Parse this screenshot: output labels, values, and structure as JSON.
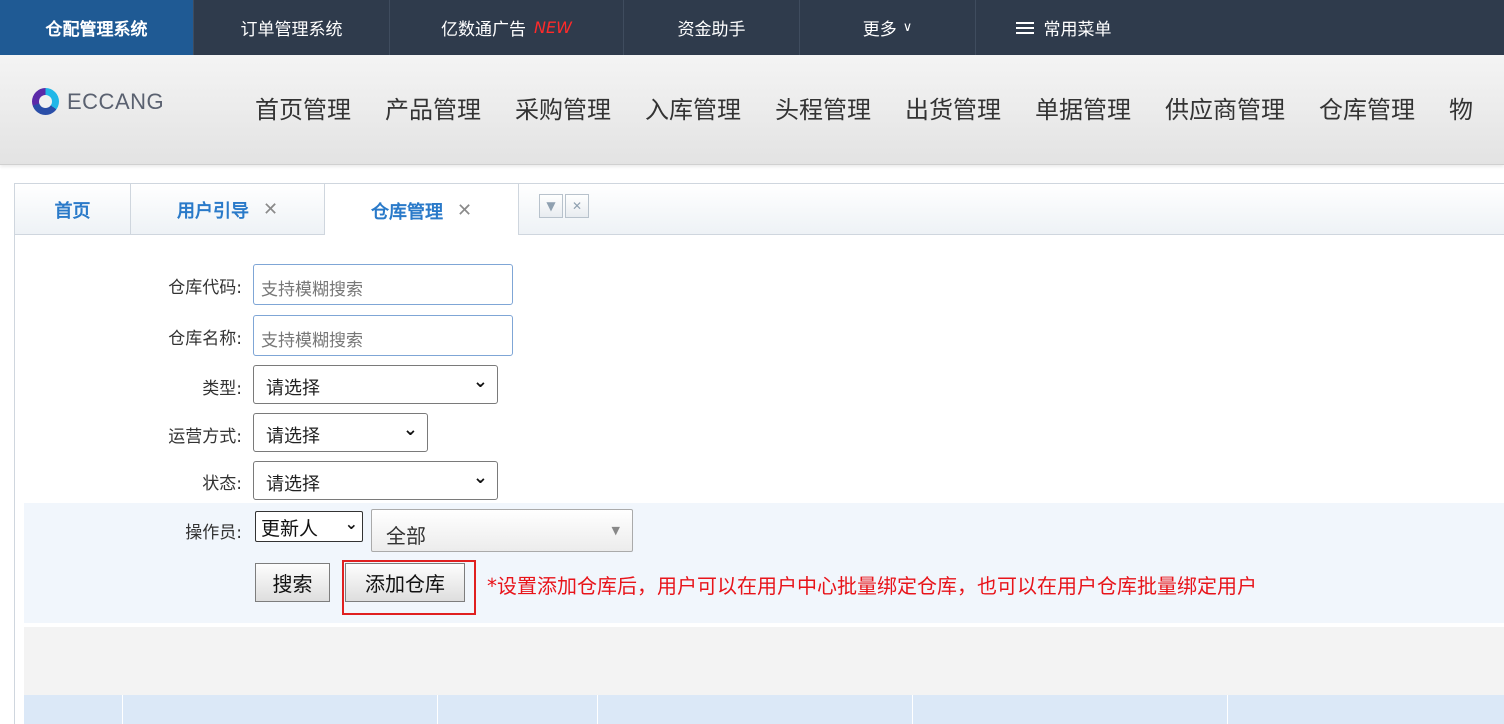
{
  "system_tabs": [
    {
      "label": "仓配管理系统",
      "active": true
    },
    {
      "label": "订单管理系统"
    },
    {
      "label": "亿数通广告",
      "badge": "NEW"
    },
    {
      "label": "资金助手"
    },
    {
      "label": "更多",
      "chevron": "∨"
    },
    {
      "label": "常用菜单",
      "icon": "menu-lines-icon"
    }
  ],
  "brand": {
    "logo_text": "ECCANG"
  },
  "main_nav": [
    "首页管理",
    "产品管理",
    "采购管理",
    "入库管理",
    "头程管理",
    "出货管理",
    "单据管理",
    "供应商管理",
    "仓库管理",
    "物"
  ],
  "page_tabs": [
    {
      "label": "首页"
    },
    {
      "label": "用户引导",
      "close": "✕"
    },
    {
      "label": "仓库管理",
      "close": "✕",
      "active": true
    }
  ],
  "filters": {
    "warehouse_code": {
      "label": "仓库代码:",
      "placeholder": "支持模糊搜索"
    },
    "warehouse_name": {
      "label": "仓库名称:",
      "placeholder": "支持模糊搜索"
    },
    "type": {
      "label": "类型:",
      "value": "请选择"
    },
    "operation_mode": {
      "label": "运营方式:",
      "value": "请选择"
    },
    "status": {
      "label": "状态:",
      "value": "请选择"
    },
    "operator": {
      "label": "操作员:",
      "field_value": "更新人",
      "value": "全部"
    }
  },
  "actions": {
    "search": "搜索",
    "add_warehouse": "添加仓库",
    "hint": "*设置添加仓库后，用户可以在用户中心批量绑定仓库，也可以在用户仓库批量绑定用户"
  },
  "colors": {
    "topbar": "#2f3b4c",
    "active_system_tab": "#1f5a94",
    "tab_text": "#2a7ac9",
    "hint": "#e8141a",
    "highlight_border": "#e02020"
  }
}
